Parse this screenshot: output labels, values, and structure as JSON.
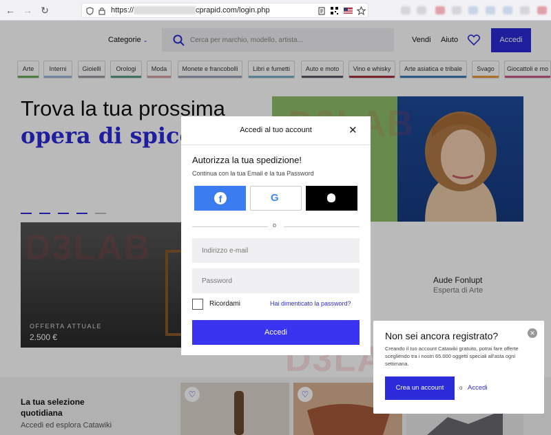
{
  "browser": {
    "url_prefix": "https://",
    "url_visible": "cprapid.com/login.php"
  },
  "header": {
    "categories_label": "Categorie",
    "search_placeholder": "Cerca per marchio, modello, artista...",
    "sell": "Vendi",
    "help": "Aiuto",
    "login": "Accedi"
  },
  "categories": [
    {
      "label": "Arte",
      "color": "#6aaa5a"
    },
    {
      "label": "Interni",
      "color": "#9ab8d8"
    },
    {
      "label": "Gioielli",
      "color": "#9aa0a8"
    },
    {
      "label": "Orologi",
      "color": "#5a9a8a"
    },
    {
      "label": "Moda",
      "color": "#d8a0a0"
    },
    {
      "label": "Monete e francobolli",
      "color": "#9aa4b8"
    },
    {
      "label": "Libri e fumetti",
      "color": "#7ab0c8"
    },
    {
      "label": "Auto e moto",
      "color": "#5a5a6a"
    },
    {
      "label": "Vino e whisky",
      "color": "#a83040"
    },
    {
      "label": "Arte asiatica e tribale",
      "color": "#3a7ab8"
    },
    {
      "label": "Svago",
      "color": "#e89a3a"
    },
    {
      "label": "Giocattoli e mo",
      "color": "#c85a8a"
    }
  ],
  "hero": {
    "title": "Trova la tua prossima",
    "subtitle": "opera di spicco",
    "offer_label": "OFFERTA ATTUALE",
    "offer_value": "2.500 €",
    "expert_name": "Aude Fonlupt",
    "expert_role": "Esperta di Arte"
  },
  "selection": {
    "title_line1": "La tua selezione",
    "title_line2": "quotidiana",
    "desc": "Accedi ed esplora Catawiki"
  },
  "watermark": "D3LAB",
  "modal": {
    "title": "Accedi al tuo account",
    "heading": "Autorizza la tua spedizione!",
    "subheading": "Continua con la tua Email e la tua Password",
    "or": "o",
    "email_placeholder": "Indirizzo e-mail",
    "password_placeholder": "Password",
    "remember": "Ricordami",
    "forgot": "Hai dimenticato la password?",
    "submit": "Accedi"
  },
  "register": {
    "title": "Non sei ancora registrato?",
    "text": "Creando il tuo account Catawiki gratuito, potrai fare offerte scegliendo tra i nostri 65.000 oggetti speciali all'asta ogni settimana.",
    "create_button": "Crea un account",
    "or": "o",
    "login_link": "Accedi"
  }
}
